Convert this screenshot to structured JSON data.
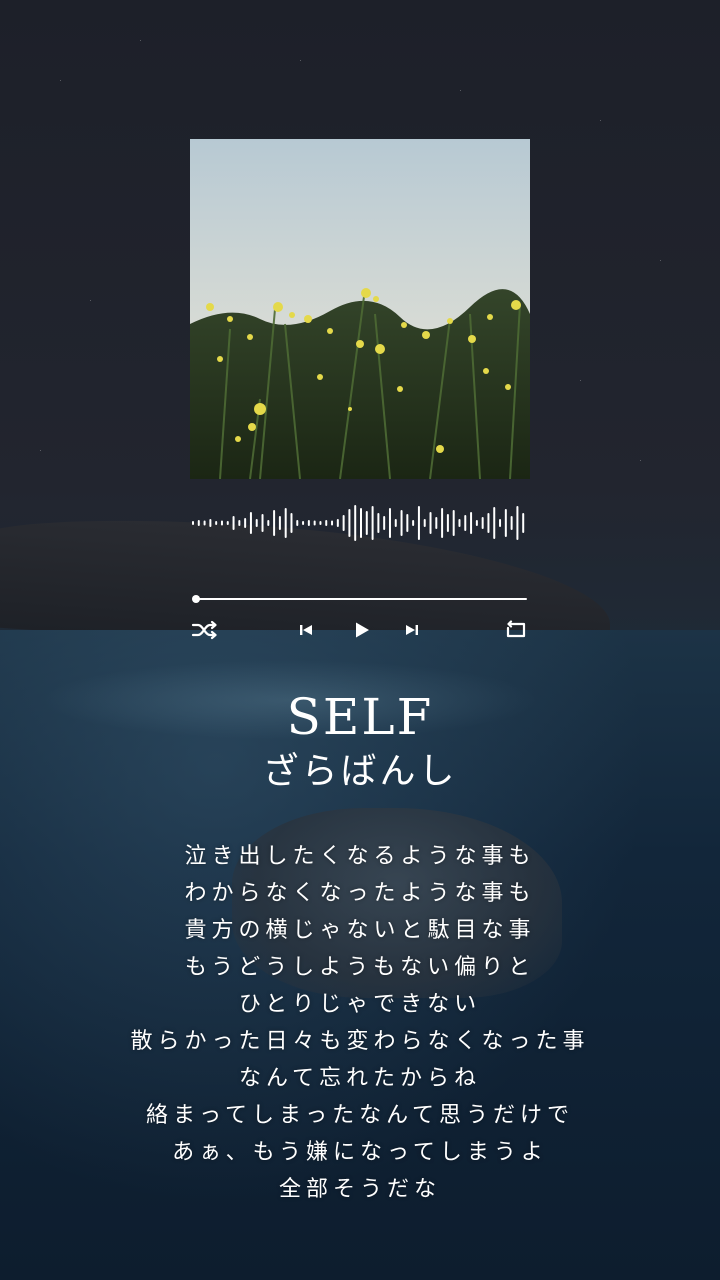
{
  "track": {
    "title": "SELF",
    "artist": "ざらばんし"
  },
  "playback": {
    "progress": 0.0
  },
  "controls": {
    "shuffle_icon": "shuffle-icon",
    "previous_icon": "skip-previous-icon",
    "play_icon": "play-icon",
    "next_icon": "skip-next-icon",
    "repeat_icon": "repeat-icon"
  },
  "lyrics": [
    "泣き出したくなるような事も",
    "わからなくなったような事も",
    "貴方の横じゃないと駄目な事",
    "もうどうしようもない偏りと",
    "ひとりじゃできない",
    "散らかった日々も変わらなくなった事",
    "なんて忘れたからね",
    "絡まってしまったなんて思うだけで",
    "あぁ、もう嫌になってしまうよ",
    "全部そうだな"
  ],
  "colors": {
    "accent": "#ffffff",
    "background": "#1e2230"
  }
}
